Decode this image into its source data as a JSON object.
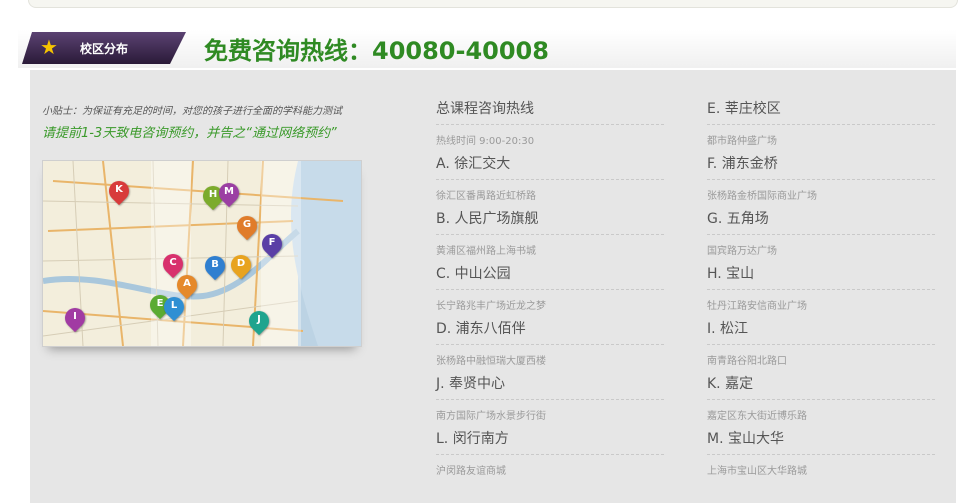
{
  "header": {
    "tag_label": "校区分布",
    "hotline_title": "免费咨询热线：40080-40008"
  },
  "tip": {
    "line1": "小贴士：为保证有充足的时间，对您的孩子进行全面的学科能力测试",
    "line2": "请提前1-3天致电咨询预约，并告之“通过网络预约”"
  },
  "map": {
    "pins": [
      {
        "label": "K",
        "color": "#d83b3b"
      },
      {
        "label": "H",
        "color": "#7cab2c"
      },
      {
        "label": "M",
        "color": "#9b3fa3"
      },
      {
        "label": "G",
        "color": "#e07c2a"
      },
      {
        "label": "F",
        "color": "#5a3fa6"
      },
      {
        "label": "C",
        "color": "#d8306d"
      },
      {
        "label": "B",
        "color": "#2f7fd0"
      },
      {
        "label": "D",
        "color": "#e8a31f"
      },
      {
        "label": "A",
        "color": "#e5892b"
      },
      {
        "label": "E",
        "color": "#5bab33"
      },
      {
        "label": "L",
        "color": "#2f8fd3"
      },
      {
        "label": "J",
        "color": "#1fa48e"
      },
      {
        "label": "I",
        "color": "#a13ba3"
      }
    ]
  },
  "campuses_left": [
    {
      "name": "总课程咨询热线",
      "addr": "热线时间 9:00-20:30"
    },
    {
      "name": "A. 徐汇交大",
      "addr": "徐汇区番禺路近虹桥路"
    },
    {
      "name": "B. 人民广场旗舰",
      "addr": "黄浦区福州路上海书城"
    },
    {
      "name": "C. 中山公园",
      "addr": "长宁路兆丰广场近龙之梦"
    },
    {
      "name": "D. 浦东八佰伴",
      "addr": "张杨路中融恒瑞大厦西楼"
    },
    {
      "name": "J. 奉贤中心",
      "addr": "南方国际广场水景步行街"
    },
    {
      "name": "L. 闵行南方",
      "addr": "沪闵路友谊商城"
    }
  ],
  "campuses_right": [
    {
      "name": "E. 莘庄校区",
      "addr": "都市路仲盛广场"
    },
    {
      "name": "F. 浦东金桥",
      "addr": "张杨路金桥国际商业广场"
    },
    {
      "name": "G. 五角场",
      "addr": "国宾路万达广场"
    },
    {
      "name": "H. 宝山",
      "addr": "牡丹江路安信商业广场"
    },
    {
      "name": "I. 松江",
      "addr": "南青路谷阳北路口"
    },
    {
      "name": "K. 嘉定",
      "addr": "嘉定区东大街近博乐路"
    },
    {
      "name": "M. 宝山大华",
      "addr": "上海市宝山区大华路城"
    }
  ]
}
